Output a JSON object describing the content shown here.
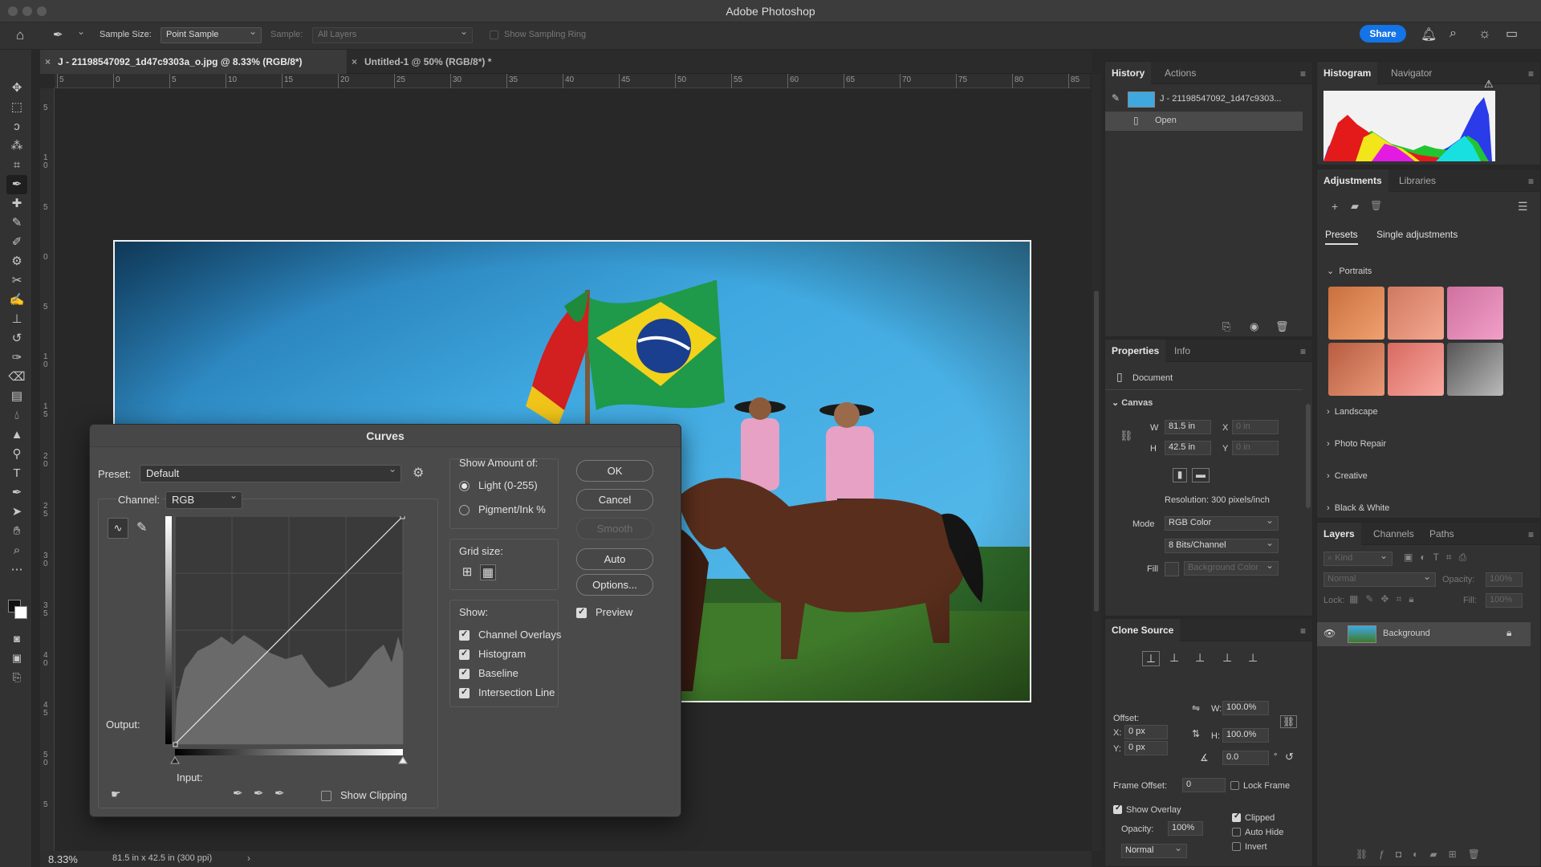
{
  "app": {
    "title": "Adobe Photoshop"
  },
  "options_bar": {
    "sample_size_label": "Sample Size:",
    "sample_size_value": "Point Sample",
    "sample_label": "Sample:",
    "sample_value": "All Layers",
    "show_sampling_ring": "Show Sampling Ring",
    "share": "Share"
  },
  "doc_tabs": [
    {
      "title": "J - 21198547092_1d47c9303a_o.jpg @ 8.33% (RGB/8*)",
      "active": true
    },
    {
      "title": "Untitled-1 @ 50% (RGB/8*) *",
      "active": false
    }
  ],
  "ruler": {
    "h_labels": [
      "5",
      "0",
      "5",
      "10",
      "15",
      "20",
      "25",
      "30",
      "35",
      "40",
      "45",
      "50",
      "55",
      "60",
      "65",
      "70",
      "75",
      "80",
      "85"
    ],
    "v_labels": [
      "5",
      "1 0",
      "5",
      "0",
      "5",
      "1 0",
      "1 5",
      "2 0",
      "2 5",
      "3 0",
      "3 5",
      "4 0",
      "4 5",
      "5 0",
      "5"
    ]
  },
  "status": {
    "zoom": "8.33%",
    "doc_info": "81.5 in x 42.5 in (300 ppi)"
  },
  "history_panel": {
    "tabs": [
      "History",
      "Actions"
    ],
    "snapshot": "J - 21198547092_1d47c9303...",
    "items": [
      "Open"
    ]
  },
  "histogram_panel": {
    "tabs": [
      "Histogram",
      "Navigator"
    ]
  },
  "adjustments_panel": {
    "tabs": [
      "Adjustments",
      "Libraries"
    ],
    "subtabs": [
      "Presets",
      "Single adjustments"
    ],
    "groups": [
      "Portraits",
      "Landscape",
      "Photo Repair",
      "Creative",
      "Black & White"
    ]
  },
  "properties_panel": {
    "tabs": [
      "Properties",
      "Info"
    ],
    "doc_label": "Document",
    "canvas_label": "Canvas",
    "w_label": "W",
    "w_value": "81.5 in",
    "h_label": "H",
    "h_value": "42.5 in",
    "x_label": "X",
    "x_value": "0 in",
    "y_label": "Y",
    "y_value": "0 in",
    "resolution": "Resolution: 300 pixels/inch",
    "mode_label": "Mode",
    "mode_value": "RGB Color",
    "bits_value": "8 Bits/Channel",
    "fill_label": "Fill",
    "fill_value": "Background Color"
  },
  "clone_source_panel": {
    "tab": "Clone Source",
    "offset_label": "Offset:",
    "x_label": "X:",
    "x_value": "0 px",
    "y_label": "Y:",
    "y_value": "0 px",
    "w_label": "W:",
    "w_value": "100.0%",
    "h_label": "H:",
    "h_value": "100.0%",
    "angle_value": "0.0",
    "angle_unit": "°",
    "frame_offset_label": "Frame Offset:",
    "frame_offset_value": "0",
    "lock_frame": "Lock Frame",
    "show_overlay": "Show Overlay",
    "opacity_label": "Opacity:",
    "opacity_value": "100%",
    "blend_value": "Normal",
    "clipped": "Clipped",
    "auto_hide": "Auto Hide",
    "invert": "Invert"
  },
  "layers_panel": {
    "tabs": [
      "Layers",
      "Channels",
      "Paths"
    ],
    "kind": "Kind",
    "blend": "Normal",
    "opacity_label": "Opacity:",
    "opacity_value": "100%",
    "lock_label": "Lock:",
    "fill_label": "Fill:",
    "fill_value": "100%",
    "layer_name": "Background"
  },
  "curves": {
    "title": "Curves",
    "preset_label": "Preset:",
    "preset_value": "Default",
    "channel_label": "Channel:",
    "channel_value": "RGB",
    "output_label": "Output:",
    "input_label": "Input:",
    "show_clipping": "Show Clipping",
    "show_amount_title": "Show Amount of:",
    "light": "Light  (0-255)",
    "pigment": "Pigment/Ink %",
    "grid_size_label": "Grid size:",
    "show_title": "Show:",
    "show_options": [
      "Channel Overlays",
      "Histogram",
      "Baseline",
      "Intersection Line"
    ],
    "buttons": {
      "ok": "OK",
      "cancel": "Cancel",
      "smooth": "Smooth",
      "auto": "Auto",
      "options": "Options..."
    },
    "preview": "Preview"
  },
  "colors": {
    "accent": "#1473e6",
    "panel": "#323232",
    "dialog": "#4a4a4a",
    "sky": "#3fa8e0"
  }
}
